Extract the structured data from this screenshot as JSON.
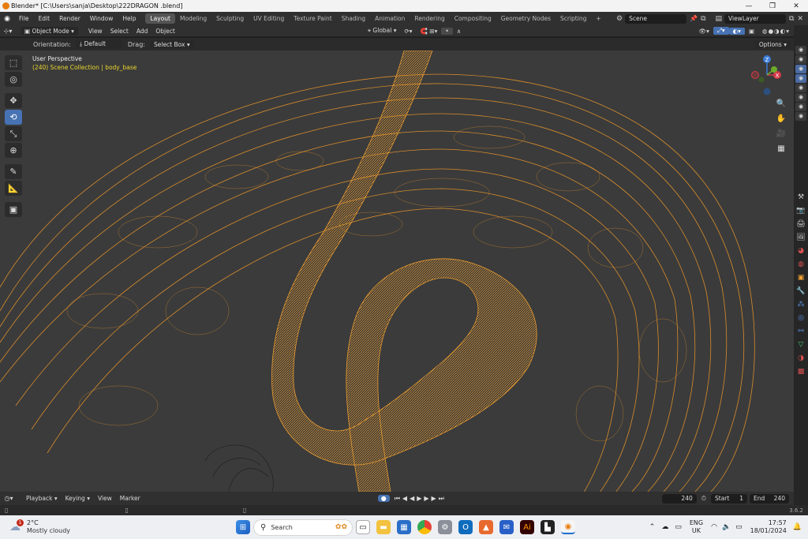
{
  "window": {
    "title": "Blender* [C:\\Users\\sanja\\Desktop\\222DRAGON .blend]",
    "controls": [
      "—",
      "❐",
      "✕"
    ]
  },
  "menus": [
    "File",
    "Edit",
    "Render",
    "Window",
    "Help"
  ],
  "workspaces": [
    "Layout",
    "Modeling",
    "Sculpting",
    "UV Editing",
    "Texture Paint",
    "Shading",
    "Animation",
    "Rendering",
    "Compositing",
    "Geometry Nodes",
    "Scripting"
  ],
  "active_workspace": "Layout",
  "scene": {
    "name": "Scene",
    "view_layer": "ViewLayer"
  },
  "header": {
    "mode": "Object Mode",
    "view": "View",
    "select": "Select",
    "add": "Add",
    "object": "Object",
    "transform_orientation": "Global"
  },
  "toolsettings": {
    "orientation_label": "Orientation:",
    "orientation_value": "Default",
    "drag_label": "Drag:",
    "drag_value": "Select Box",
    "options": "Options"
  },
  "viewport": {
    "perspective": "User Perspective",
    "collection_info": "(240) Scene Collection | body_base"
  },
  "gizmo": {
    "z": "Z",
    "x": "X",
    "y": "Y"
  },
  "timeline": {
    "playback": "Playback",
    "keying": "Keying",
    "view": "View",
    "marker": "Marker",
    "current_frame": "240",
    "start_label": "Start",
    "start": "1",
    "end_label": "End",
    "end": "240"
  },
  "version": "3.6.2",
  "taskbar": {
    "temperature": "2°C",
    "weather": "Mostly cloudy",
    "search": "Search",
    "lang1": "ENG",
    "lang2": "UK",
    "time": "17:57",
    "date": "18/01/2024"
  },
  "colors": {
    "wire": "#f0a030",
    "accent": "#4772b3",
    "grid_bg": "#3b3b3b"
  }
}
